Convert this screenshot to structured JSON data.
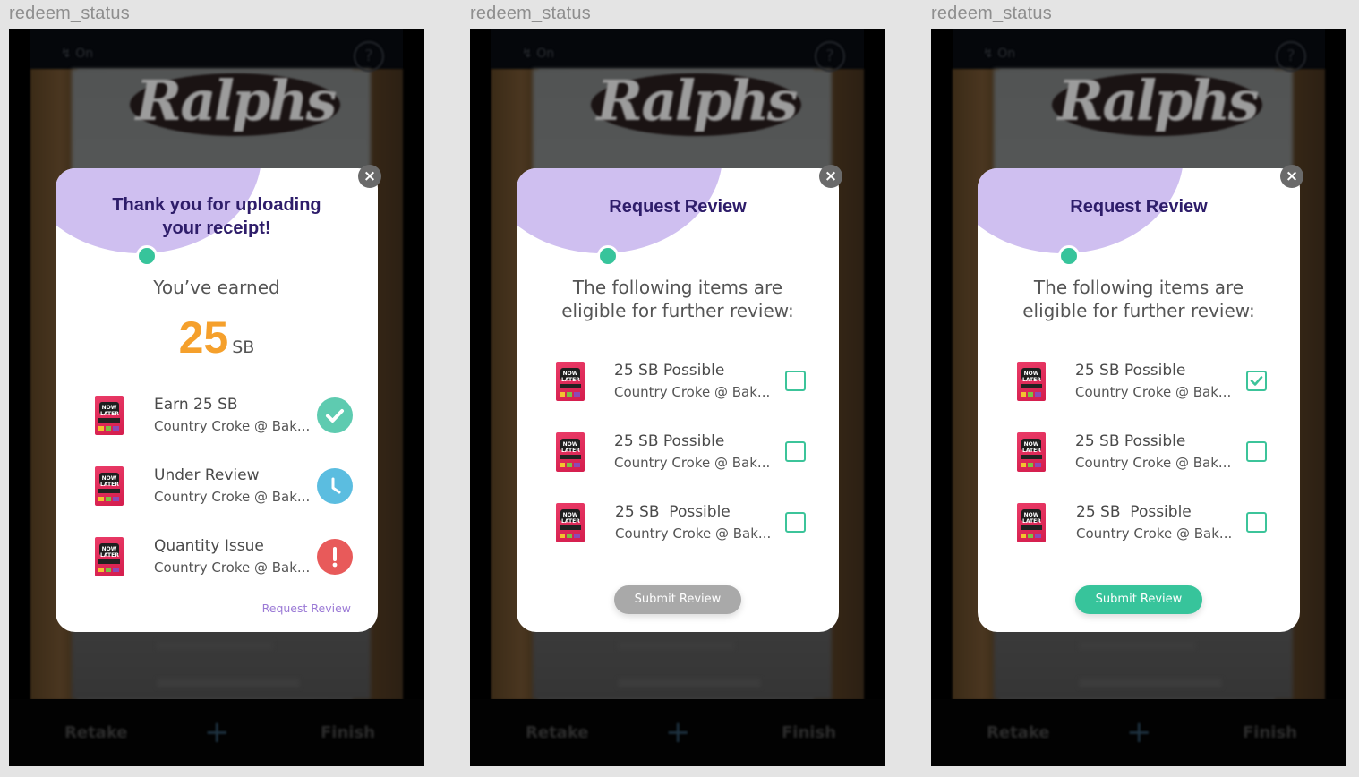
{
  "artboards": [
    {
      "label": "redeem_status",
      "camera": {
        "flash_label": "On",
        "store_logo": "Ralphs",
        "help_icon": "?",
        "bottom_bar": {
          "left": "Retake",
          "center": "+",
          "right": "Finish"
        }
      },
      "modal": {
        "title_line1": "Thank you for uploading",
        "title_line2": "your receipt!",
        "earned_label": "You’ve earned",
        "earned_value": "25",
        "earned_unit": "SB",
        "items": [
          {
            "title": "Earn 25 SB",
            "subtitle": "Country Croke @ Bak...",
            "status": "approved",
            "status_icon": "check-icon",
            "status_color": "#5ecbb0"
          },
          {
            "title": "Under Review",
            "subtitle": "Country Croke @ Bak...",
            "status": "pending",
            "status_icon": "clock-icon",
            "status_color": "#5bbde0"
          },
          {
            "title": "Quantity Issue",
            "subtitle": "Country Croke @ Bak...",
            "status": "error",
            "status_icon": "exclamation-icon",
            "status_color": "#e85a5a"
          }
        ],
        "link_label": "Request Review",
        "close_icon": "×"
      }
    },
    {
      "label": "redeem_status",
      "camera": {
        "flash_label": "On",
        "store_logo": "Ralphs",
        "help_icon": "?",
        "bottom_bar": {
          "left": "Retake",
          "center": "+",
          "right": "Finish"
        }
      },
      "modal": {
        "title": "Request Review",
        "subtitle_line1": "The following items are",
        "subtitle_line2": "eligible for further review:",
        "items": [
          {
            "title": "25 SB Possible",
            "subtitle": "Country Croke @ Bak...",
            "checked": false
          },
          {
            "title": "25 SB Possible",
            "subtitle": "Country Croke @ Bak...",
            "checked": false
          },
          {
            "title": "25 SB  Possible",
            "subtitle": "Country Croke @ Bak...",
            "checked": false
          }
        ],
        "submit_label": "Submit Review",
        "submit_enabled": false,
        "close_icon": "×"
      }
    },
    {
      "label": "redeem_status",
      "camera": {
        "flash_label": "On",
        "store_logo": "Ralphs",
        "help_icon": "?",
        "bottom_bar": {
          "left": "Retake",
          "center": "+",
          "right": "Finish"
        }
      },
      "modal": {
        "title": "Request Review",
        "subtitle_line1": "The following items are",
        "subtitle_line2": "eligible for further review:",
        "items": [
          {
            "title": "25 SB Possible",
            "subtitle": "Country Croke @ Bak...",
            "checked": true
          },
          {
            "title": "25 SB Possible",
            "subtitle": "Country Croke @ Bak...",
            "checked": false
          },
          {
            "title": "25 SB  Possible",
            "subtitle": "Country Croke @ Bak...",
            "checked": false
          }
        ],
        "submit_label": "Submit Review",
        "submit_enabled": true,
        "close_icon": "×"
      }
    }
  ],
  "colors": {
    "accent_purple": "#cfbff0",
    "title_purple": "#2e1d6a",
    "teal": "#37c49b",
    "orange": "#f5a02c",
    "link_purple": "#9b7ad6",
    "disabled_gray": "#a9a9a9"
  }
}
